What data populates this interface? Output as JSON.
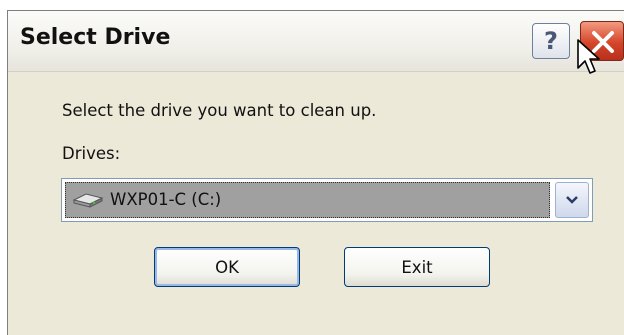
{
  "window": {
    "title": "Select Drive",
    "help_label": "?"
  },
  "content": {
    "prompt": "Select the drive you want to clean up.",
    "drives_label": "Drives:"
  },
  "drive_select": {
    "selected_value": "WXP01-C (C:)",
    "icon": "hard-drive-icon"
  },
  "buttons": {
    "ok_label": "OK",
    "exit_label": "Exit"
  },
  "colors": {
    "dialog_bg": "#ece9d8",
    "close_button": "#d5452a",
    "selection": "#a0a0a0"
  }
}
